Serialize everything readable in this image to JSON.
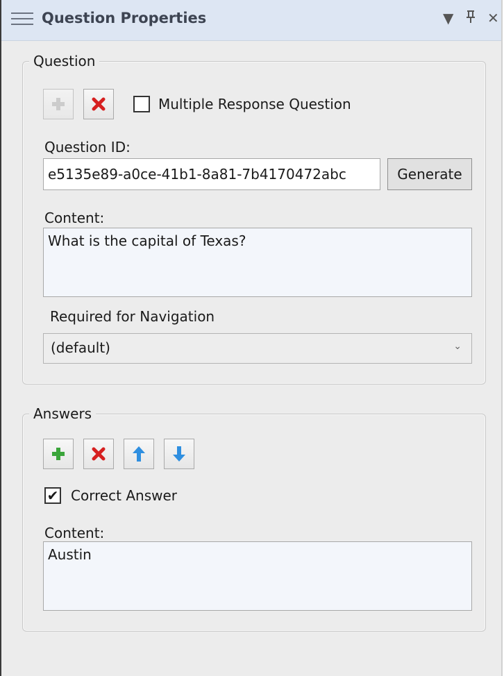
{
  "panel": {
    "title": "Question Properties"
  },
  "question": {
    "group_label": "Question",
    "multiple_response_label": "Multiple Response Question",
    "multiple_response_checked": false,
    "id_label": "Question ID:",
    "id_value": "e5135e89-a0ce-41b1-8a81-7b4170472abc",
    "generate_label": "Generate",
    "content_label": "Content:",
    "content_value": "What is the capital of Texas?",
    "required_nav_label": "Required for Navigation",
    "required_nav_value": "(default)"
  },
  "answers": {
    "group_label": "Answers",
    "correct_answer_label": "Correct Answer",
    "correct_answer_checked": true,
    "content_label": "Content:",
    "content_value": "Austin"
  },
  "colors": {
    "titlebar_bg": "#dde6f3",
    "panel_bg": "#ececec",
    "add_icon": "#3aa53a",
    "delete_icon": "#d62020",
    "arrow_icon": "#2f8fe0"
  }
}
